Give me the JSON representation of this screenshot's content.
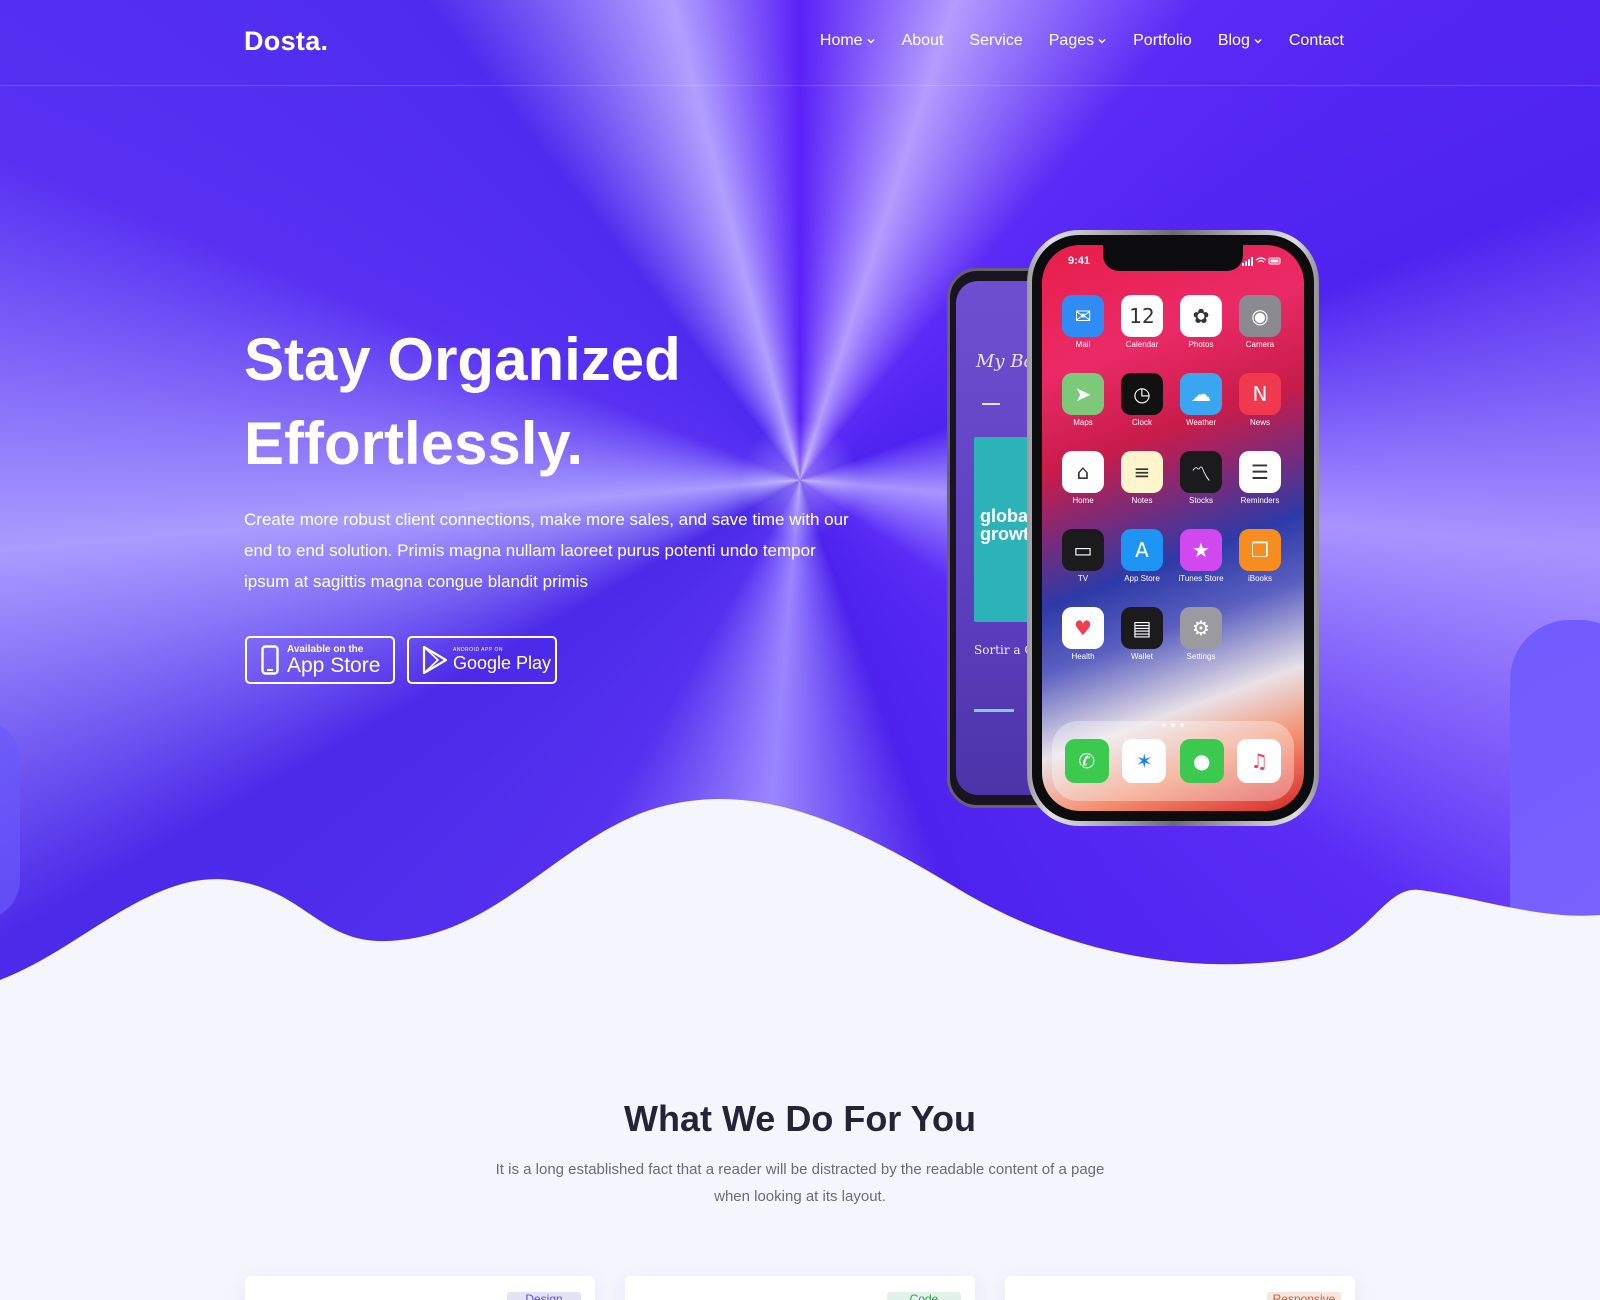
{
  "brand": {
    "logo": "Dosta."
  },
  "nav": {
    "items": [
      {
        "label": "Home",
        "dropdown": true
      },
      {
        "label": "About",
        "dropdown": false
      },
      {
        "label": "Service",
        "dropdown": false
      },
      {
        "label": "Pages",
        "dropdown": true
      },
      {
        "label": "Portfolio",
        "dropdown": false
      },
      {
        "label": "Blog",
        "dropdown": true
      },
      {
        "label": "Contact",
        "dropdown": false
      }
    ]
  },
  "hero": {
    "title_line1": "Stay Organized",
    "title_line2": "Effortlessly.",
    "description": "Create more robust client connections, make more sales, and save time with our end to end solution. Primis magna nullam laoreet purus potenti undo tempor ipsum at sagittis magna congue blandit primis",
    "appstore": {
      "small": "Available on the",
      "big": "App Store"
    },
    "googleplay": {
      "small": "ANDROID APP ON",
      "big": "Google Play"
    }
  },
  "phone_back": {
    "title": "My Book",
    "cover_text": "global growth",
    "subtitle": "Sortir a Cann"
  },
  "phone": {
    "time": "9:41",
    "apps": [
      {
        "label": "Mail",
        "icon": "mail-icon",
        "color": "#2f8cf5",
        "glyph": "✉"
      },
      {
        "label": "Calendar",
        "icon": "calendar-icon",
        "color": "#ffffff",
        "glyph": "12"
      },
      {
        "label": "Photos",
        "icon": "photos-icon",
        "color": "#ffffff",
        "glyph": "✿"
      },
      {
        "label": "Camera",
        "icon": "camera-icon",
        "color": "#8a8a90",
        "glyph": "◉"
      },
      {
        "label": "Maps",
        "icon": "maps-icon",
        "color": "#7cc97a",
        "glyph": "➤"
      },
      {
        "label": "Clock",
        "icon": "clock-icon",
        "color": "#111111",
        "glyph": "◷"
      },
      {
        "label": "Weather",
        "icon": "weather-icon",
        "color": "#3aa6f0",
        "glyph": "☁"
      },
      {
        "label": "News",
        "icon": "news-icon",
        "color": "#f0394f",
        "glyph": "N"
      },
      {
        "label": "Home",
        "icon": "home-icon",
        "color": "#ffffff",
        "glyph": "⌂"
      },
      {
        "label": "Notes",
        "icon": "notes-icon",
        "color": "#fff5cc",
        "glyph": "≡"
      },
      {
        "label": "Stocks",
        "icon": "stocks-icon",
        "color": "#1b1b1d",
        "glyph": "〽"
      },
      {
        "label": "Reminders",
        "icon": "reminders-icon",
        "color": "#ffffff",
        "glyph": "☰"
      },
      {
        "label": "TV",
        "icon": "tv-icon",
        "color": "#1b1b1d",
        "glyph": "▭"
      },
      {
        "label": "App Store",
        "icon": "app-store-icon",
        "color": "#1e95f5",
        "glyph": "A"
      },
      {
        "label": "iTunes Store",
        "icon": "itunes-store-icon",
        "color": "#d248f0",
        "glyph": "★"
      },
      {
        "label": "iBooks",
        "icon": "ibooks-icon",
        "color": "#f58d1f",
        "glyph": "❒"
      },
      {
        "label": "Health",
        "icon": "health-icon",
        "color": "#ffffff",
        "glyph": "♥"
      },
      {
        "label": "Wallet",
        "icon": "wallet-icon",
        "color": "#1b1b1d",
        "glyph": "▤"
      },
      {
        "label": "Settings",
        "icon": "settings-icon",
        "color": "#9a9aa0",
        "glyph": "⚙"
      }
    ],
    "dock": [
      {
        "icon": "phone-icon",
        "color": "#3cc94f",
        "glyph": "✆"
      },
      {
        "icon": "safari-icon",
        "color": "#ffffff",
        "glyph": "✶"
      },
      {
        "icon": "messages-icon",
        "color": "#3cc94f",
        "glyph": "●"
      },
      {
        "icon": "music-icon",
        "color": "#ffffff",
        "glyph": "♫"
      }
    ]
  },
  "services": {
    "title": "What We Do For You",
    "subtitle": "It is a long established fact that a reader will be distracted by the readable content of a page when looking at its layout.",
    "cards": [
      {
        "tag": "Design",
        "tag_bg": "#e3e3f6",
        "tag_color": "#5a4ad0"
      },
      {
        "tag": "Code",
        "tag_bg": "#e3f2e8",
        "tag_color": "#2f9a55"
      },
      {
        "tag": "Responsive",
        "tag_bg": "#f6e6e0",
        "tag_color": "#c0603a"
      }
    ]
  }
}
